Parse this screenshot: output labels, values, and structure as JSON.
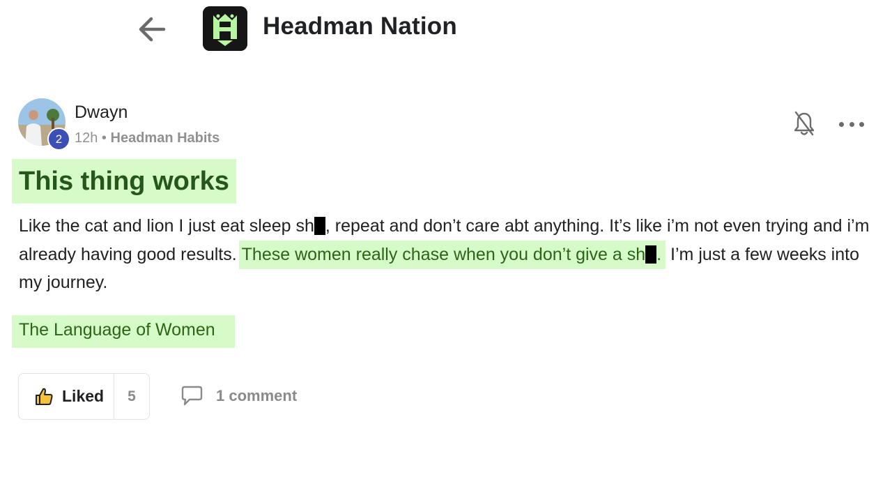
{
  "header": {
    "back_icon": "arrow-left-icon",
    "group_logo_icon": "headman-logo-icon",
    "group_name": "Headman Nation"
  },
  "post": {
    "author": {
      "name": "Dwayn",
      "avatar": "user-photo",
      "level": "2"
    },
    "time": "12h",
    "separator": " • ",
    "category": "Headman Habits",
    "bell_icon": "bell-off-icon",
    "more_icon": "ellipsis-icon",
    "title": "This thing works",
    "body": {
      "part1": "Like the cat and lion I just eat sleep sh",
      "part2": ", repeat and don’t care abt anything. It’s like i’m not even trying and i’m already having good results. ",
      "highlight_a": "These women really chase when you don’t give a sh",
      "highlight_b": ".",
      "part3": " I’m just a few weeks into my journey."
    },
    "link_text": "The Language of Women"
  },
  "actions": {
    "like_icon": "thumbs-up-icon",
    "like_label": "Liked",
    "like_count": "5",
    "comment_icon": "comment-bubble-icon",
    "comment_label": "1 comment"
  },
  "colors": {
    "highlight_bg": "#d6fbc8",
    "highlight_text": "#2c6418",
    "level_badge": "#3c4fb4",
    "logo_accent": "#b8f5a0"
  }
}
